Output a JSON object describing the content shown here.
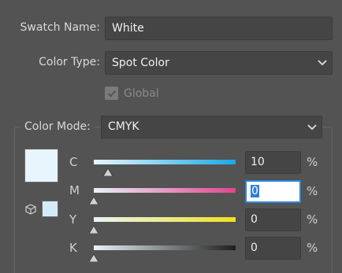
{
  "swatch_name": {
    "label": "Swatch Name:",
    "value": "White"
  },
  "color_type": {
    "label": "Color Type:",
    "selected": "Spot Color"
  },
  "global": {
    "label": "Global",
    "checked": true,
    "enabled": false
  },
  "color_mode": {
    "label": "Color Mode:",
    "selected": "CMYK"
  },
  "swatch_colors": {
    "preview": "#e8f5fd",
    "nearest": "#d4ecf9"
  },
  "channels": [
    {
      "label": "C",
      "value": "10",
      "unit": "%",
      "fraction": 0.1,
      "active": false
    },
    {
      "label": "M",
      "value": "0",
      "unit": "%",
      "fraction": 0.0,
      "active": true
    },
    {
      "label": "Y",
      "value": "0",
      "unit": "%",
      "fraction": 0.0,
      "active": false
    },
    {
      "label": "K",
      "value": "0",
      "unit": "%",
      "fraction": 0.0,
      "active": false
    }
  ],
  "colors": {
    "panel_bg": "#535353",
    "field_bg": "#454545",
    "focus_border": "#2d86e0"
  }
}
